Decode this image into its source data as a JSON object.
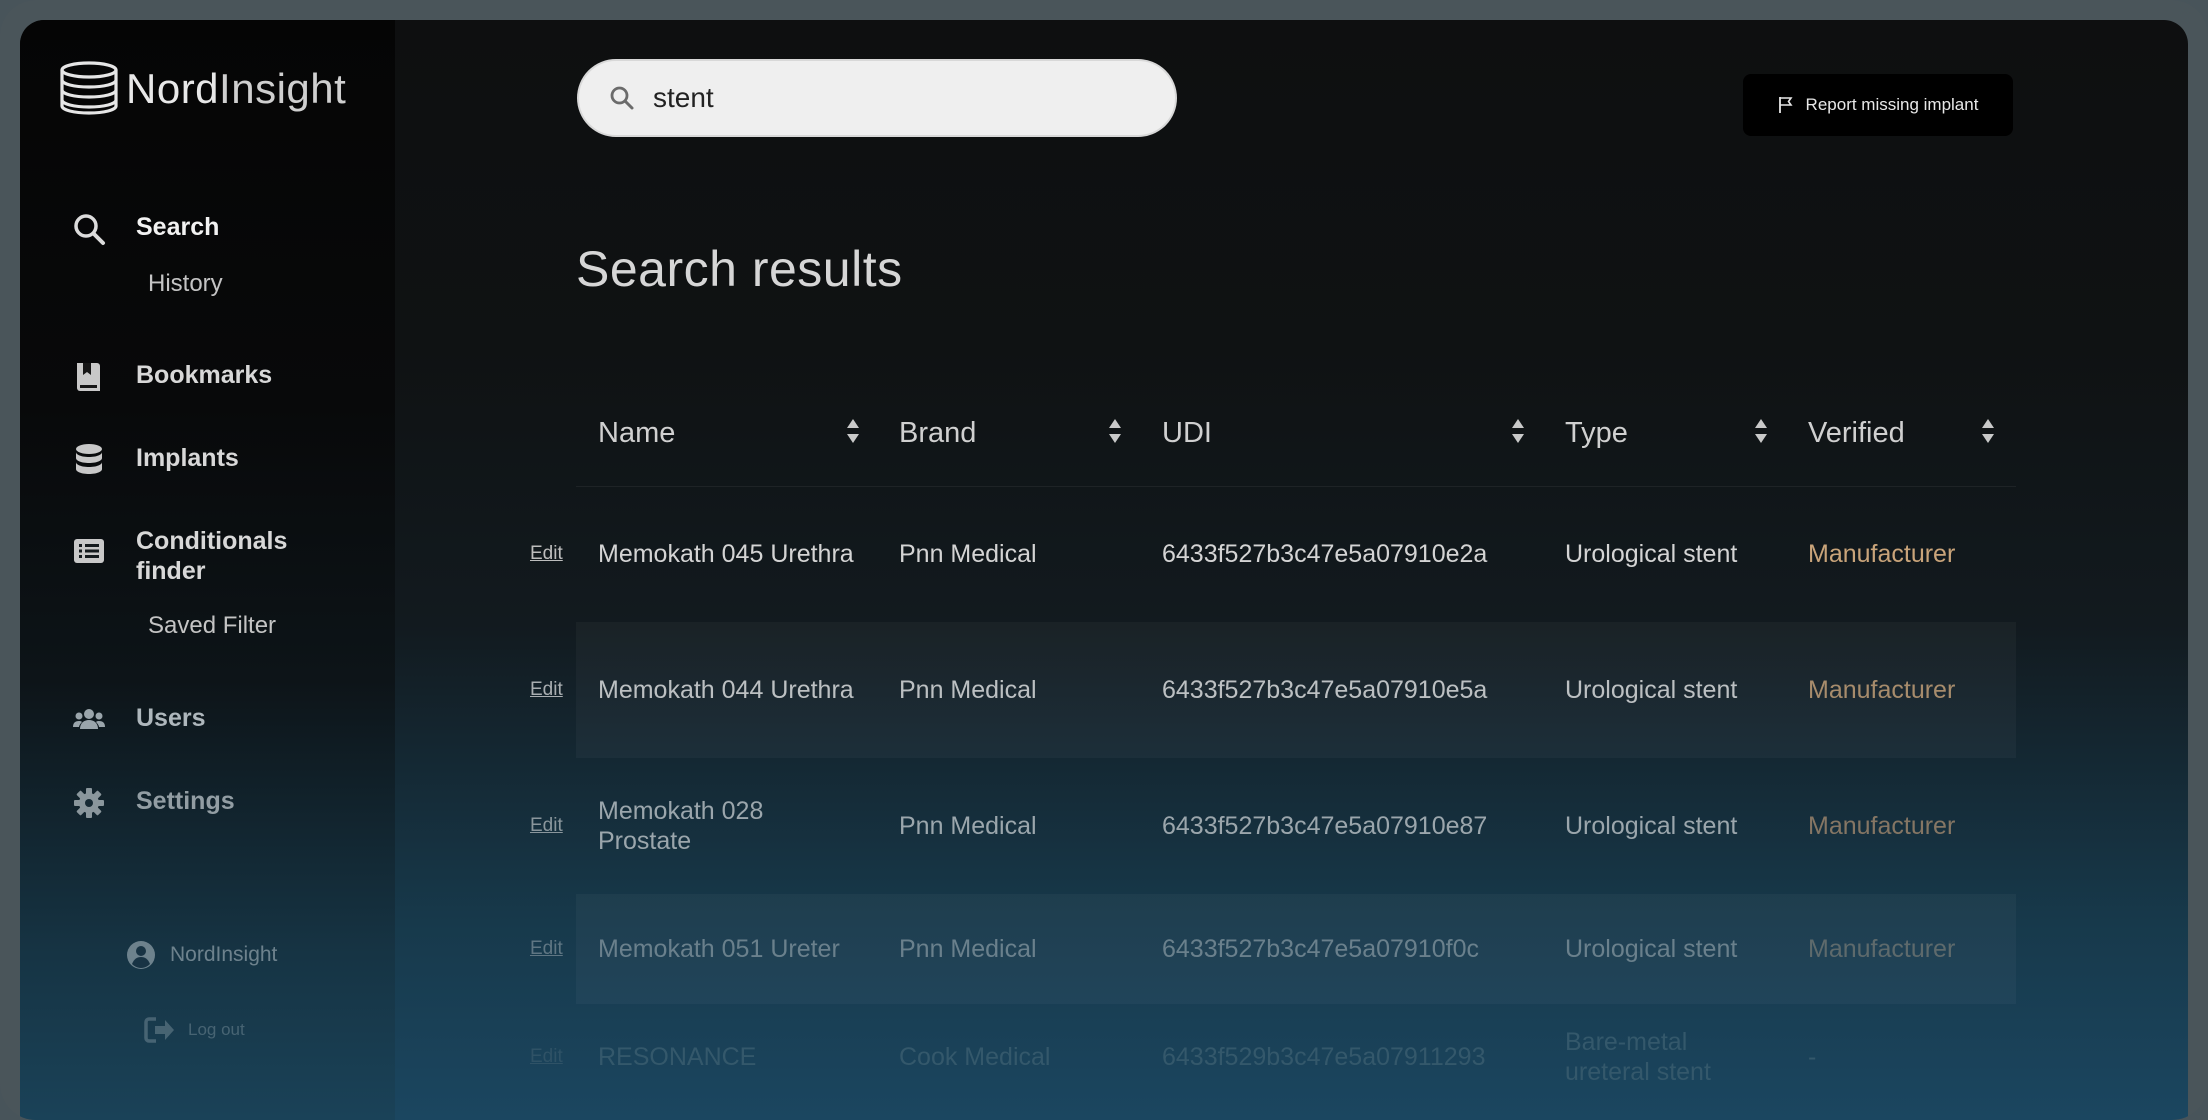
{
  "app": {
    "logo_bold": "Nord",
    "logo_light": "Insight"
  },
  "sidebar": {
    "items": [
      {
        "label": "Search",
        "icon": "search-icon"
      },
      {
        "label": "Bookmarks",
        "icon": "bookmark-icon"
      },
      {
        "label": "Implants",
        "icon": "database-icon"
      },
      {
        "label": "Conditionals finder",
        "icon": "list-icon"
      },
      {
        "label": "Users",
        "icon": "users-icon"
      },
      {
        "label": "Settings",
        "icon": "gear-icon"
      }
    ],
    "sub_history": "History",
    "sub_saved_filter": "Saved Filter",
    "profile_name": "NordInsight",
    "logout_label": "Log out"
  },
  "search": {
    "value": "stent"
  },
  "header": {
    "report_label": "Report missing implant"
  },
  "main": {
    "title": "Search results",
    "columns": [
      "Name",
      "Brand",
      "UDI",
      "Type",
      "Verified"
    ],
    "edit_label": "Edit",
    "rows": [
      {
        "name": "Memokath 045 Urethra",
        "brand": "Pnn Medical",
        "udi": "6433f527b3c47e5a07910e2a",
        "type": "Urological stent",
        "verified": "Manufacturer"
      },
      {
        "name": "Memokath 044 Urethra",
        "brand": "Pnn Medical",
        "udi": "6433f527b3c47e5a07910e5a",
        "type": "Urological stent",
        "verified": "Manufacturer"
      },
      {
        "name": "Memokath 028 Prostate",
        "brand": "Pnn Medical",
        "udi": "6433f527b3c47e5a07910e87",
        "type": "Urological stent",
        "verified": "Manufacturer"
      },
      {
        "name": "Memokath 051 Ureter",
        "brand": "Pnn Medical",
        "udi": "6433f527b3c47e5a07910f0c",
        "type": "Urological stent",
        "verified": "Manufacturer"
      },
      {
        "name": "RESONANCE",
        "brand": "Cook Medical",
        "udi": "6433f529b3c47e5a07911293",
        "type": "Bare-metal ureteral stent",
        "verified": "-"
      }
    ]
  },
  "colors": {
    "verified": "#c9a47a",
    "text": "#d4d4d4"
  }
}
